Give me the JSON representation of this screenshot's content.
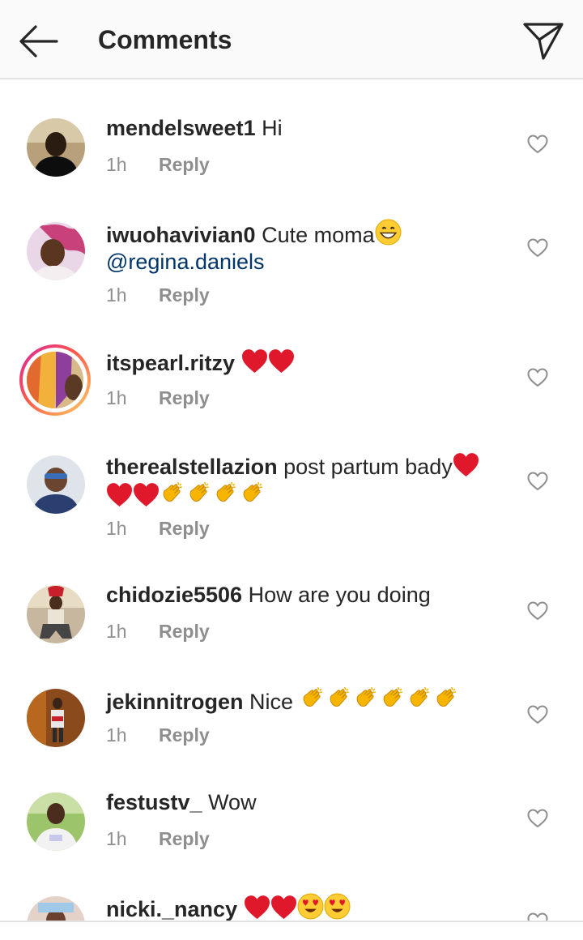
{
  "header": {
    "title": "Comments"
  },
  "comments": [
    {
      "username": "mendelsweet1",
      "text": "Hi",
      "time": "1h",
      "reply": "Reply"
    },
    {
      "username": "iwuohavivian0",
      "text": "Cute moma",
      "mention": "@regina.daniels",
      "time": "1h",
      "reply": "Reply"
    },
    {
      "username": "itspearl.ritzy",
      "text": "",
      "time": "1h",
      "reply": "Reply"
    },
    {
      "username": "therealstellazion",
      "text": "post partum bady",
      "time": "1h",
      "reply": "Reply"
    },
    {
      "username": "chidozie5506",
      "text": "How are you doing",
      "time": "1h",
      "reply": "Reply"
    },
    {
      "username": "jekinnitrogen",
      "text": "Nice",
      "time": "1h",
      "reply": "Reply"
    },
    {
      "username": "festustv_",
      "text": "Wow",
      "time": "1h",
      "reply": "Reply"
    },
    {
      "username": "nicki._nancy",
      "text": "",
      "time": "",
      "reply": ""
    }
  ],
  "colors": {
    "mention": "#003569",
    "muted": "#8e8e8e",
    "heart_emoji": "#e0182c",
    "clap_emoji": "#f7b500"
  },
  "icons": {
    "back": "arrow-left-icon",
    "send": "paper-plane-icon",
    "like": "heart-outline-icon"
  }
}
